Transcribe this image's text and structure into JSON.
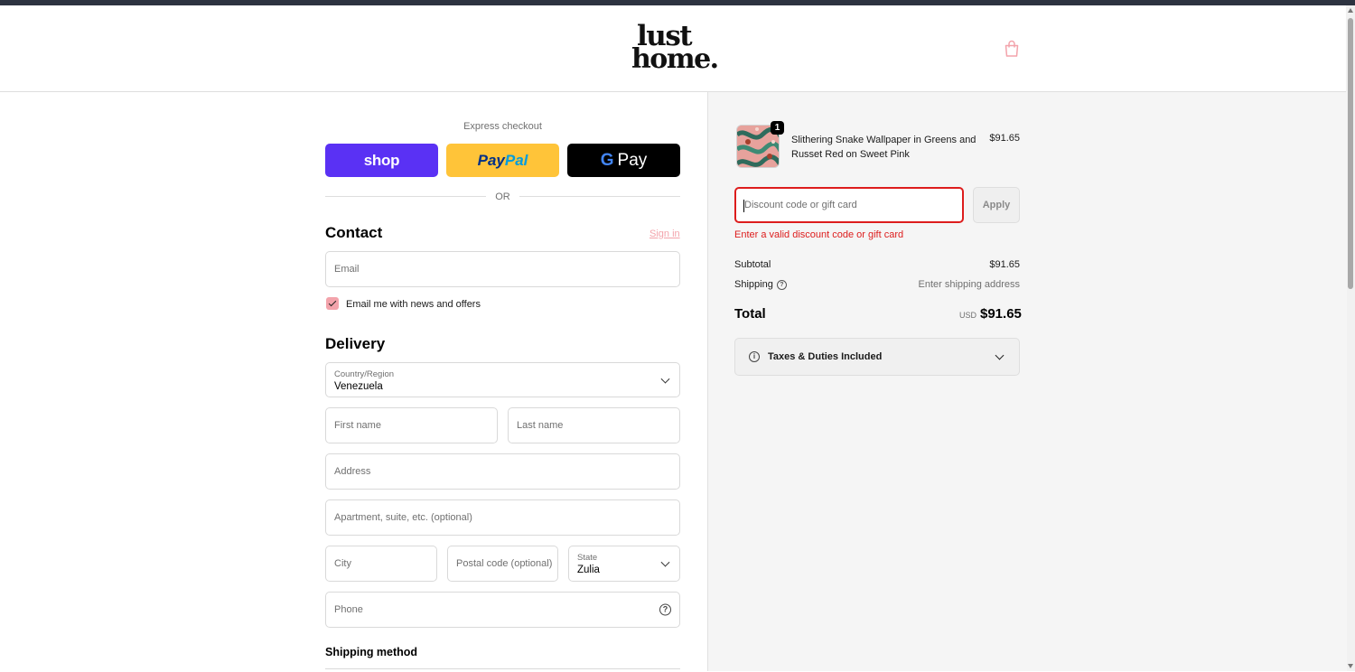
{
  "header": {
    "logo_line1": "lust",
    "logo_line2": "home."
  },
  "express": {
    "label": "Express checkout",
    "shop_label": "shop",
    "paypal_part1": "Pay",
    "paypal_part2": "Pal",
    "gpay_g": "G",
    "gpay_label": "Pay",
    "or_label": "OR"
  },
  "contact": {
    "title": "Contact",
    "sign_in": "Sign in",
    "email_placeholder": "Email",
    "newsletter_label": "Email me with news and offers",
    "newsletter_checked": true
  },
  "delivery": {
    "title": "Delivery",
    "country_label": "Country/Region",
    "country_value": "Venezuela",
    "first_name_placeholder": "First name",
    "last_name_placeholder": "Last name",
    "address_placeholder": "Address",
    "apartment_placeholder": "Apartment, suite, etc. (optional)",
    "city_placeholder": "City",
    "postal_placeholder": "Postal code (optional)",
    "state_label": "State",
    "state_value": "Zulia",
    "phone_placeholder": "Phone",
    "help_glyph": "?"
  },
  "shipping_method": {
    "title": "Shipping method"
  },
  "order": {
    "item": {
      "quantity": "1",
      "name": "Slithering Snake Wallpaper in Greens and Russet Red on Sweet Pink",
      "price": "$91.65"
    },
    "discount_placeholder": "Discount code or gift card",
    "apply_label": "Apply",
    "error_message": "Enter a valid discount code or gift card",
    "subtotal_label": "Subtotal",
    "subtotal_value": "$91.65",
    "shipping_label": "Shipping",
    "shipping_help": "?",
    "shipping_value": "Enter shipping address",
    "total_label": "Total",
    "total_currency": "USD",
    "total_value": "$91.65",
    "taxes_info": "i",
    "taxes_label": "Taxes & Duties Included"
  },
  "colors": {
    "shop": "#5a31f4",
    "paypal": "#ffc439",
    "gpay": "#000000",
    "accent_pink": "#f3a3ab",
    "error": "#dd1d1d"
  },
  "icons": {
    "cart": "shopping-bag-icon",
    "help": "question-circle-icon",
    "info": "info-circle-icon",
    "chevron": "chevron-down-icon"
  }
}
